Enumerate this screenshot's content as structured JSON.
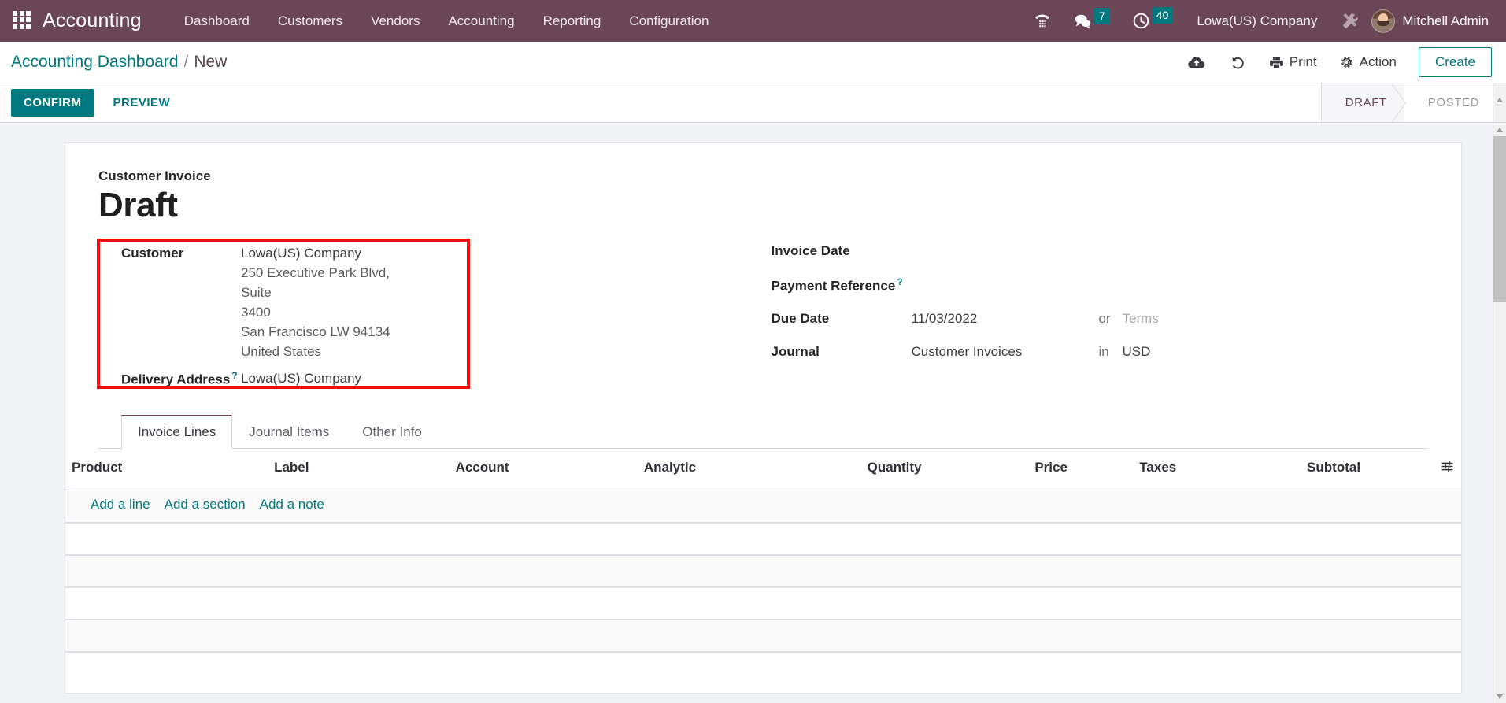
{
  "navbar": {
    "apps_icon": "apps-grid-icon",
    "brand": "Accounting",
    "menus": [
      {
        "label": "Dashboard"
      },
      {
        "label": "Customers"
      },
      {
        "label": "Vendors"
      },
      {
        "label": "Accounting"
      },
      {
        "label": "Reporting"
      },
      {
        "label": "Configuration"
      }
    ],
    "systray": {
      "voip_icon": "phone-dialpad-icon",
      "messages_icon": "chat-bubble-icon",
      "messages_count": "7",
      "activities_icon": "clock-icon",
      "activities_count": "40",
      "company": "Lowa(US) Company",
      "debug_icon": "tools-wrench-icon",
      "avatar": "user-avatar",
      "user": "Mitchell Admin"
    },
    "accent_badge_color": "#00787f",
    "background_color": "#6b4657"
  },
  "control_panel": {
    "breadcrumb": {
      "root": "Accounting Dashboard",
      "separator": "/",
      "current": "New"
    },
    "save_icon": "cloud-upload-icon",
    "discard_icon": "undo-arrow-icon",
    "print_label": "Print",
    "print_icon": "printer-icon",
    "action_label": "Action",
    "action_icon": "gear-icon",
    "create_label": "Create"
  },
  "statusbar": {
    "confirm_label": "CONFIRM",
    "preview_label": "PREVIEW",
    "stages": [
      {
        "label": "DRAFT",
        "active": true
      },
      {
        "label": "POSTED",
        "active": false
      }
    ]
  },
  "form": {
    "doc_type": "Customer Invoice",
    "doc_title": "Draft",
    "left": {
      "customer_label": "Customer",
      "customer_value": "Lowa(US) Company",
      "customer_address": [
        "250 Executive Park Blvd, Suite",
        "3400",
        "San Francisco LW 94134",
        "United States"
      ],
      "delivery_label": "Delivery Address",
      "delivery_help": "?",
      "delivery_value": "Lowa(US) Company"
    },
    "right": {
      "invoice_date_label": "Invoice Date",
      "invoice_date_value": "",
      "payment_reference_label": "Payment Reference",
      "payment_reference_help": "?",
      "payment_reference_value": "",
      "due_date_label": "Due Date",
      "due_date_value": "11/03/2022",
      "due_date_conj": "or",
      "terms_placeholder": "Terms",
      "journal_label": "Journal",
      "journal_value": "Customer Invoices",
      "journal_conj": "in",
      "currency_value": "USD"
    },
    "highlight_box_color": "#f40f0f"
  },
  "notebook": {
    "tabs": [
      {
        "label": "Invoice Lines",
        "active": true
      },
      {
        "label": "Journal Items",
        "active": false
      },
      {
        "label": "Other Info",
        "active": false
      }
    ],
    "columns": [
      {
        "label": "Product",
        "align": "left"
      },
      {
        "label": "Label",
        "align": "left"
      },
      {
        "label": "Account",
        "align": "left"
      },
      {
        "label": "Analytic",
        "align": "left"
      },
      {
        "label": "Quantity",
        "align": "right"
      },
      {
        "label": "Price",
        "align": "right"
      },
      {
        "label": "Taxes",
        "align": "left"
      },
      {
        "label": "Subtotal",
        "align": "right"
      }
    ],
    "optional_columns_icon": "sliders-settings-icon",
    "rows": [],
    "add_links": [
      {
        "label": "Add a line"
      },
      {
        "label": "Add a section"
      },
      {
        "label": "Add a note"
      }
    ]
  }
}
